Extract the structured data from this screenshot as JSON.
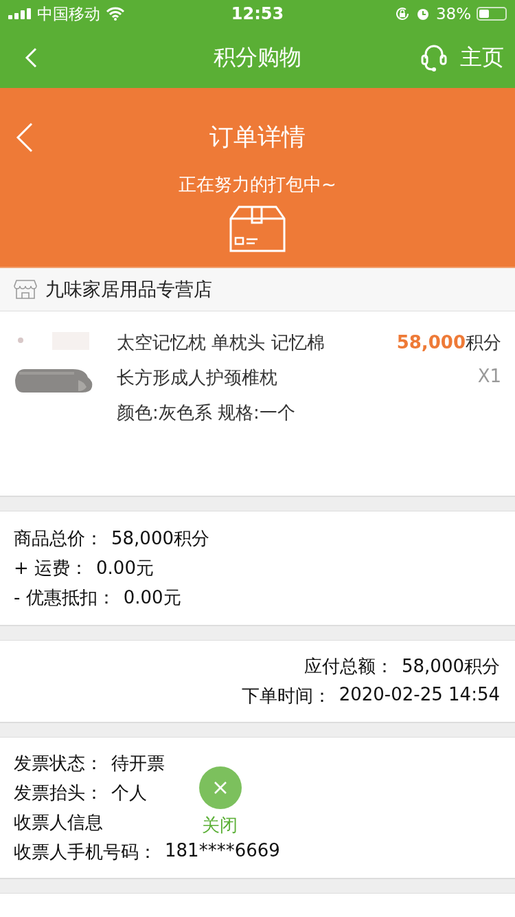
{
  "status_bar": {
    "carrier": "中国移动",
    "time": "12:53",
    "battery": "38%"
  },
  "nav": {
    "title": "积分购物",
    "home": "主页"
  },
  "header": {
    "title": "订单详情",
    "status": "正在努力的打包中~"
  },
  "store": {
    "name": "九味家居用品专营店"
  },
  "product": {
    "title_line1": "太空记忆枕 单枕头 记忆棉",
    "title_line2": "长方形成人护颈椎枕",
    "spec": "颜色:灰色系 规格:一个",
    "price": "58,000",
    "price_unit": "积分",
    "quantity": "X1"
  },
  "price_summary": [
    {
      "label": "商品总价：",
      "value": "58,000积分"
    },
    {
      "label": "+ 运费：",
      "value": "0.00元"
    },
    {
      "label": "- 优惠抵扣：",
      "value": "0.00元"
    }
  ],
  "totals": [
    {
      "label": "应付总额：",
      "value": "58,000积分"
    },
    {
      "label": "下单时间：",
      "value": "2020-02-25 14:54"
    }
  ],
  "invoice": [
    {
      "label": "发票状态：",
      "value": "待开票"
    },
    {
      "label": "发票抬头：",
      "value": "个人"
    },
    {
      "label": "收票人信息"
    },
    {
      "label": "收票人手机号码：",
      "value": "181****6669"
    }
  ],
  "float_button": {
    "label": "关闭"
  }
}
